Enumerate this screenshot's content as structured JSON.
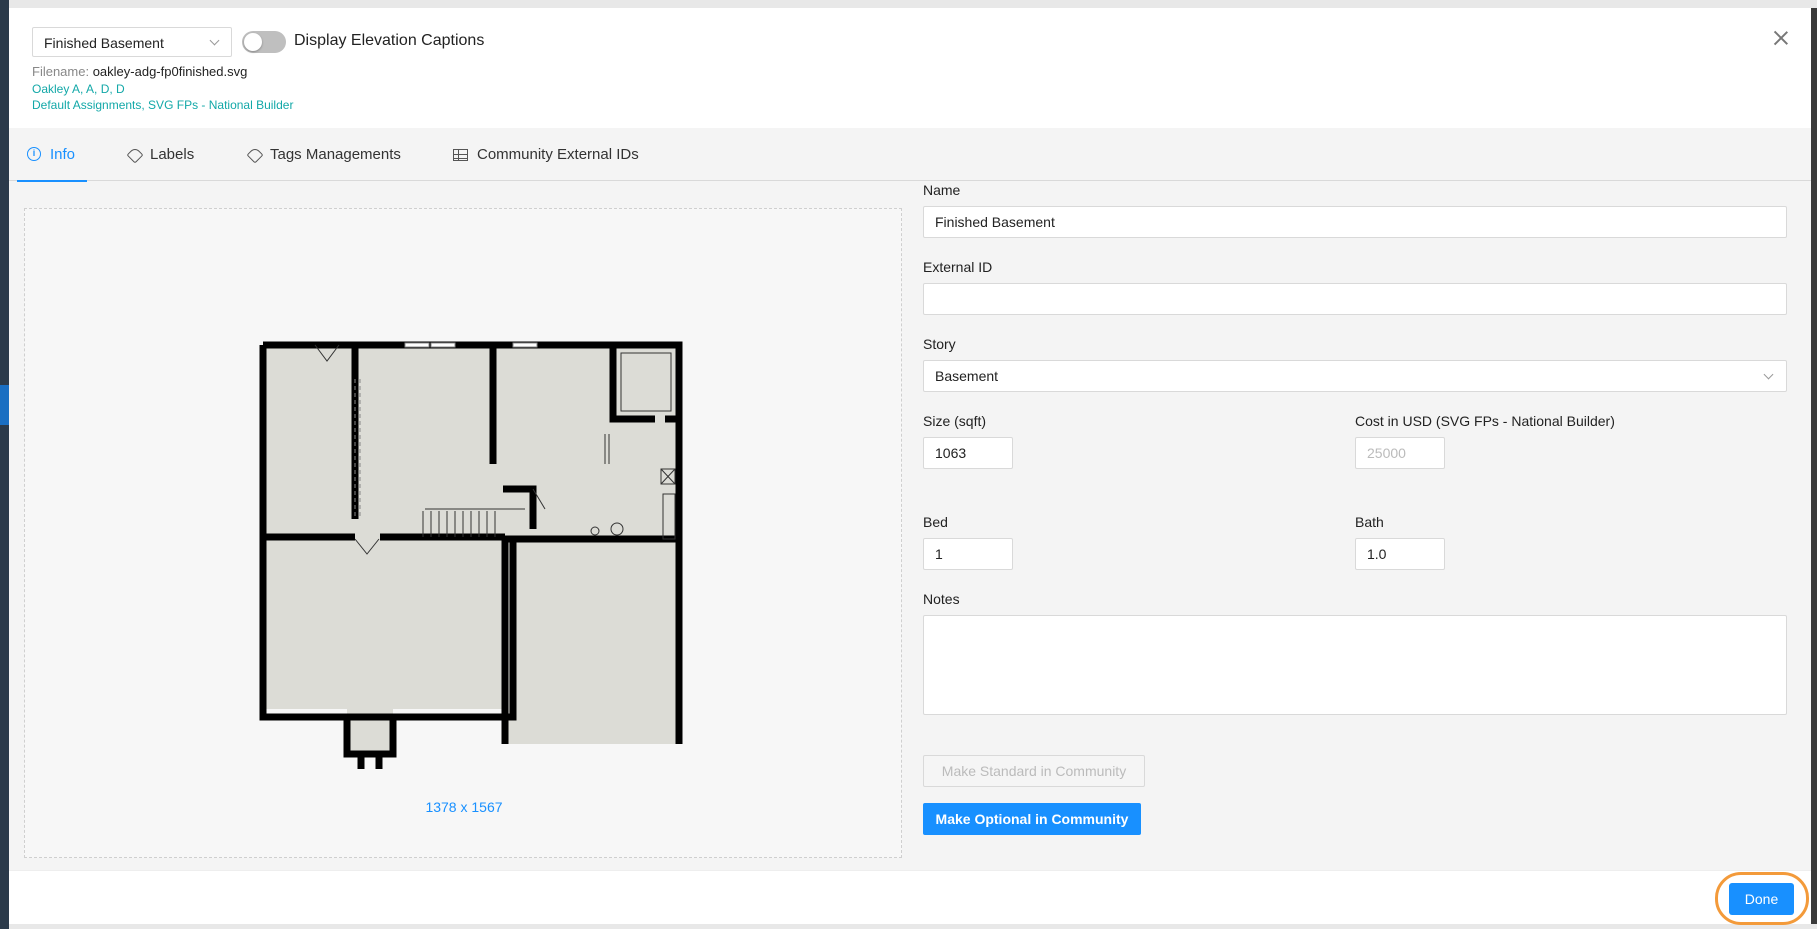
{
  "header": {
    "plan_select": "Finished Basement",
    "toggle_label": "Display Elevation Captions",
    "toggle_on": false,
    "filename_label": "Filename:",
    "filename_value": "oakley-adg-fp0finished.svg",
    "elevations_link": "Oakley A, A, D, D",
    "assignments_link": "Default Assignments, SVG FPs - National Builder"
  },
  "tabs": [
    {
      "label": "Info",
      "icon": "info-icon",
      "active": true
    },
    {
      "label": "Labels",
      "icon": "tag-icon",
      "active": false
    },
    {
      "label": "Tags Managements",
      "icon": "tag-icon",
      "active": false
    },
    {
      "label": "Community External IDs",
      "icon": "table-icon",
      "active": false
    }
  ],
  "preview": {
    "dimensions": "1378 x 1567"
  },
  "form": {
    "name_label": "Name",
    "name_value": "Finished Basement",
    "external_id_label": "External ID",
    "external_id_value": "",
    "story_label": "Story",
    "story_value": "Basement",
    "size_label": "Size (sqft)",
    "size_value": "1063",
    "cost_label": "Cost in USD (SVG FPs - National Builder)",
    "cost_placeholder": "25000",
    "bed_label": "Bed",
    "bed_value": "1",
    "bath_label": "Bath",
    "bath_value": "1.0",
    "notes_label": "Notes",
    "notes_value": "",
    "make_standard_label": "Make Standard in Community",
    "make_optional_label": "Make Optional in Community"
  },
  "footer": {
    "done_label": "Done"
  },
  "colors": {
    "primary": "#1890ff",
    "link_teal": "#13a8a8",
    "highlight_ring": "#f39a3a"
  }
}
